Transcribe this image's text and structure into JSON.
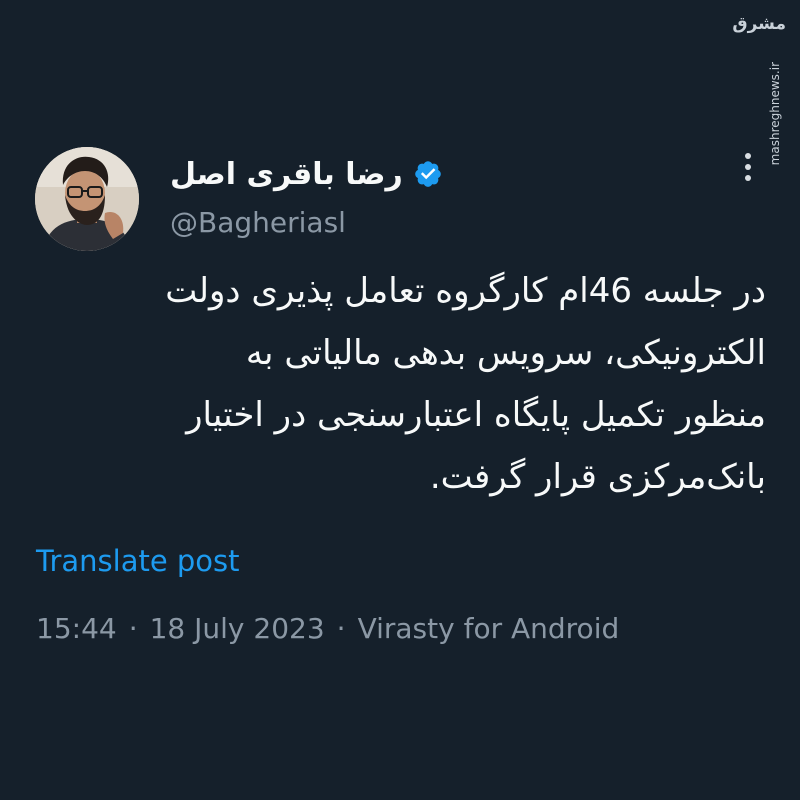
{
  "watermark": {
    "logo_text": "مشرق",
    "site": "mashreghnews.ir"
  },
  "author": {
    "display_name": "رضا باقری اصل",
    "handle": "@Bagheriasl",
    "verified": true,
    "verified_color": "#1d9bf0"
  },
  "tweet": {
    "lines": [
      "در جلسه 46ام کارگروه تعامل پذیری دولت",
      "الکترونیکی، سرویس بدهی مالیاتی به",
      "منظور تکمیل  پایگاه اعتبارسنجی در اختیار",
      "بانک‌مرکزی قرار گرفت."
    ],
    "translate_label": "Translate post",
    "time": "15:44",
    "date": "18 July 2023",
    "source": "Virasty for Android",
    "separator": "·"
  },
  "icons": {
    "more": "more-vertical-icon",
    "verified": "verified-badge-icon"
  },
  "colors": {
    "background": "#15202b",
    "text": "#f7f9f9",
    "secondary": "#8b98a5",
    "accent": "#1d9bf0"
  }
}
